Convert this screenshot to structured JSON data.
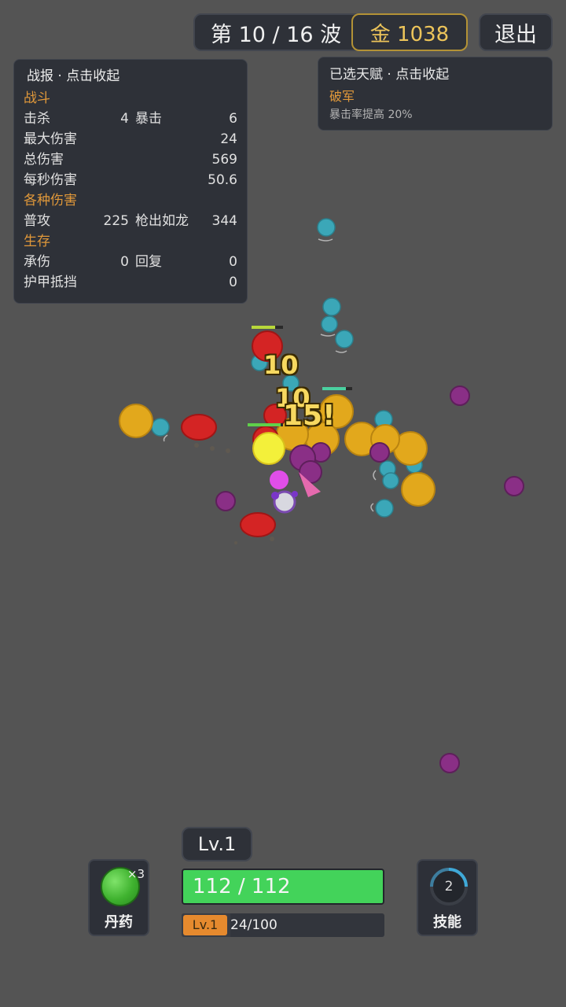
{
  "hud": {
    "wave": "第 10 / 16 波",
    "gold": "金 1038",
    "quit": "退出"
  },
  "report": {
    "title": "战报 · 点击收起",
    "combat_header": "战斗",
    "kills_label": "击杀",
    "kills": "4",
    "crit_label": "暴击",
    "crit": "6",
    "max_dmg_label": "最大伤害",
    "max_dmg": "24",
    "total_dmg_label": "总伤害",
    "total_dmg": "569",
    "dps_label": "每秒伤害",
    "dps": "50.6",
    "damage_header": "各种伤害",
    "basic_label": "普攻",
    "basic": "225",
    "skill_label": "枪出如龙",
    "skill": "344",
    "survive_header": "生存",
    "taken_label": "承伤",
    "taken": "0",
    "heal_label": "回复",
    "heal": "0",
    "armor_label": "护甲抵挡",
    "armor": "0"
  },
  "talent": {
    "title": "已选天赋 · 点击收起",
    "name": "破军",
    "desc": "暴击率提高 20%"
  },
  "floating_text": [
    "10",
    "10",
    "15!"
  ],
  "player": {
    "level_chip": "Lv.1",
    "hp": "112 / 112",
    "hp_fraction": 1.0,
    "xp_level": "Lv.1",
    "xp": "24/100",
    "xp_fraction": 0.24
  },
  "potion": {
    "label": "丹药",
    "count": "×3",
    "icon": "green-potion-orb"
  },
  "skill": {
    "label": "技能",
    "cooldown": "2",
    "icon": "cooldown-ring"
  },
  "colors": {
    "gold_text": "#ecc45a",
    "section": "#e59b3a",
    "hp": "#43d35a",
    "xp_chip": "#e68a2e",
    "enemy_cyan": "#3ba7b8",
    "enemy_purple": "#8a2f86",
    "enemy_red": "#d42424",
    "enemy_gold": "#e2a81c"
  }
}
